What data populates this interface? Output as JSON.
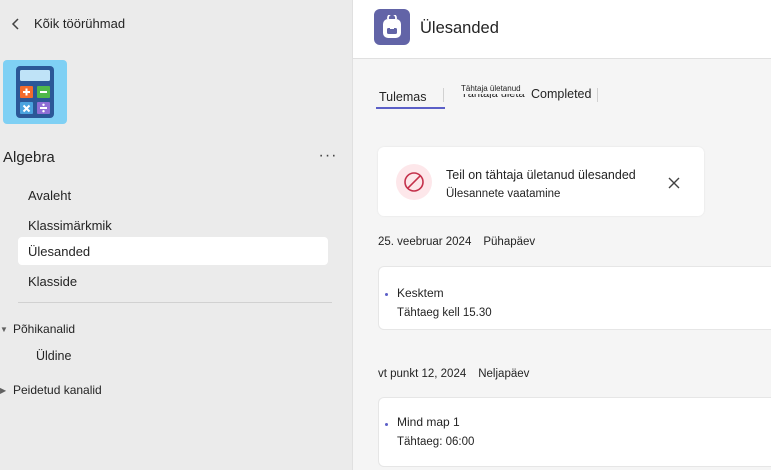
{
  "sidebar": {
    "back_label": "Kõik töörühmad",
    "team_name": "Algebra",
    "more_label": "···",
    "nav_items": [
      {
        "label": "Avaleht"
      },
      {
        "label": "Klassimärkmik"
      },
      {
        "label": "Ülesanded"
      },
      {
        "label": "Klasside"
      }
    ],
    "sections": {
      "main_channels": "Põhikanalid",
      "general": "Üldine",
      "hidden_channels": "Peidetud kanalid"
    }
  },
  "header": {
    "title": "Ülesanded"
  },
  "tabs": {
    "upcoming": "Tulemas",
    "overdue": "Tähtaja ületanud",
    "completed": "Completed"
  },
  "alert": {
    "title": "Teil on tähtaja ületanud ülesanded",
    "link": "Ülesannete vaatamine"
  },
  "groups": [
    {
      "date": "25. veebruar 2024",
      "weekday": "Pühapäev",
      "assignment": {
        "title": "Kesktem",
        "due": "Tähtaeg kell 15.30"
      }
    },
    {
      "date": "vt punkt 12, 2024",
      "weekday": "Neljapäev",
      "assignment": {
        "title": "Mind map 1",
        "due": "Tähtaeg: 06:00"
      }
    }
  ],
  "colors": {
    "accent": "#5b5fc7",
    "app_icon_bg": "#6264a7",
    "team_avatar_bg": "#7fd0f4",
    "alert_icon_bg": "#fde7ea",
    "alert_icon_fg": "#c4314b"
  },
  "icons": {
    "back": "chevron-left-icon",
    "team": "calculator-icon",
    "app": "backpack-icon",
    "alert": "prohibited-icon",
    "close": "close-icon"
  }
}
